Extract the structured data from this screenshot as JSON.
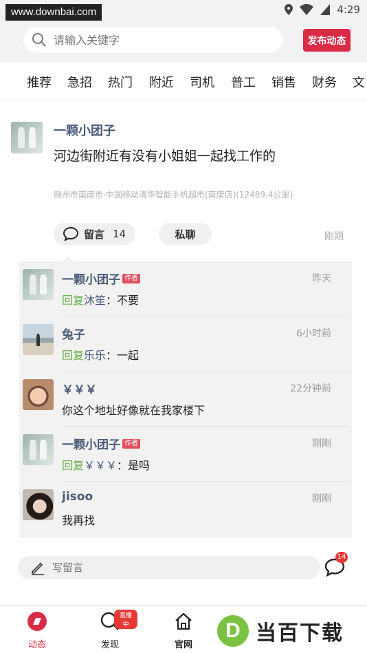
{
  "status_bar": {
    "watermark": "www.downbai.com",
    "time": "4:29"
  },
  "search": {
    "placeholder": "请输入关键字"
  },
  "publish_label": "发布动态",
  "tabs": [
    "推荐",
    "急招",
    "热门",
    "附近",
    "司机",
    "普工",
    "销售",
    "财务",
    "文"
  ],
  "post": {
    "author": "一颗小团子",
    "content": "河边街附近有没有小姐姐一起找工作的",
    "location": "赣州市南康市·中国移动清华智能手机超市(南康店)(12489.4公里)",
    "comment_label": "留言",
    "comment_count": "14",
    "chat_label": "私聊",
    "time": "刚刚"
  },
  "comments": [
    {
      "name": "一颗小团子",
      "badge": "作者",
      "reply_prefix": "回复",
      "reply_to": "沐笙",
      "text": "：不要",
      "time": "昨天",
      "avatar": "dress"
    },
    {
      "name": "兔子",
      "badge": "",
      "reply_prefix": "回复",
      "reply_to": "乐乐",
      "text": "：一起",
      "time": "6小时前",
      "avatar": "beach"
    },
    {
      "name": "￥￥￥",
      "badge": "",
      "reply_prefix": "",
      "reply_to": "",
      "text": "你这个地址好像就在我家楼下",
      "time": "22分钟前",
      "avatar": "baby"
    },
    {
      "name": "一颗小团子",
      "badge": "作者",
      "reply_prefix": "回复",
      "reply_to": "￥￥￥",
      "text": "：是吗",
      "time": "刚刚",
      "avatar": "dress"
    },
    {
      "name": "jisoo",
      "badge": "",
      "reply_prefix": "",
      "reply_to": "",
      "text": "我再找",
      "time": "刚刚",
      "avatar": "girl"
    }
  ],
  "write_placeholder": "写留言",
  "message_count": "14",
  "bottom_nav": [
    {
      "label": "动态",
      "icon": "feed-icon"
    },
    {
      "label": "发现",
      "icon": "search-icon",
      "badge": "直播中"
    },
    {
      "label": "官网",
      "icon": "home-icon"
    }
  ],
  "overlay_logo": {
    "letter": "D",
    "text": "当百下载"
  },
  "colors": {
    "accent": "#d92b45",
    "name": "#4a5a78",
    "reply": "#6ab04c"
  }
}
